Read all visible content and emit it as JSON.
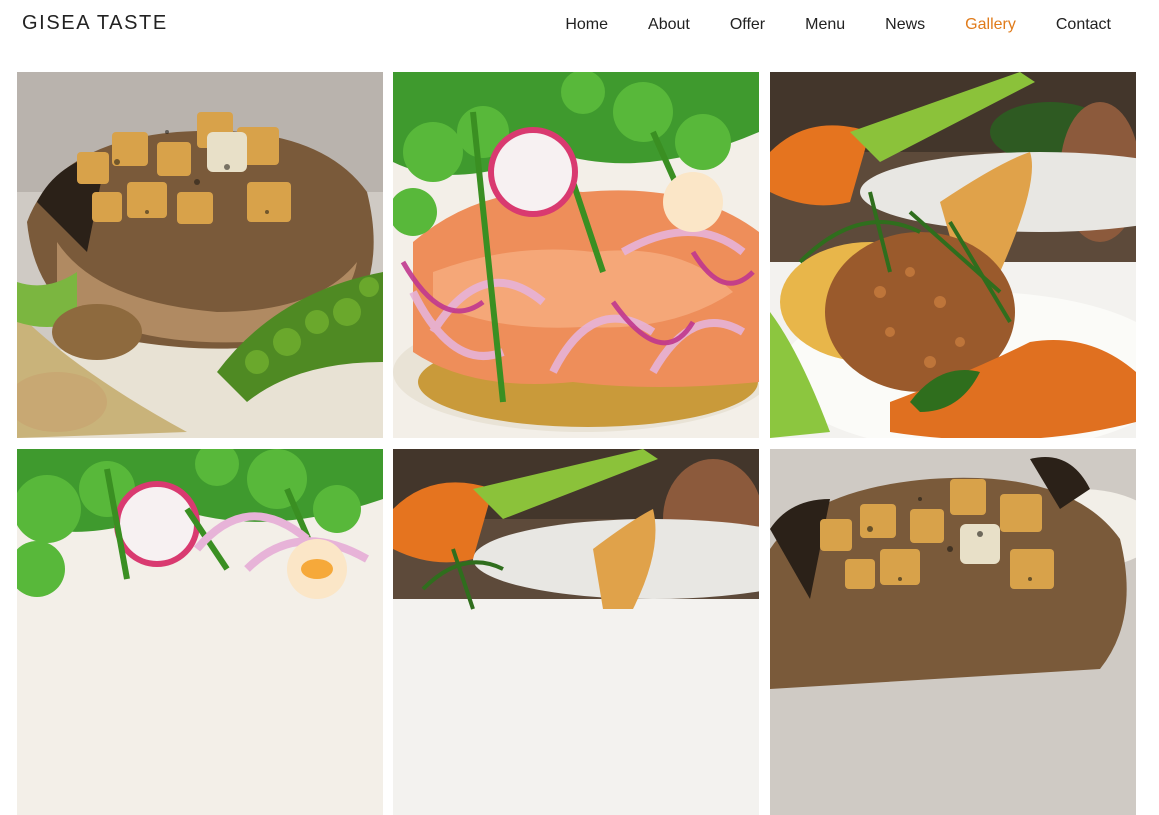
{
  "brand": {
    "name": "GISEA TASTE"
  },
  "nav": {
    "items": [
      {
        "label": "Home",
        "active": false
      },
      {
        "label": "About",
        "active": false
      },
      {
        "label": "Offer",
        "active": false
      },
      {
        "label": "Menu",
        "active": false
      },
      {
        "label": "News",
        "active": false
      },
      {
        "label": "Gallery",
        "active": true
      },
      {
        "label": "Contact",
        "active": false
      }
    ],
    "active_color": "#e07b1a"
  },
  "gallery": {
    "tiles": [
      {
        "subject": "pork-steak-potatoes"
      },
      {
        "subject": "salmon-radish-salad"
      },
      {
        "subject": "croquette-carrot"
      },
      {
        "subject": "salmon-radish-salad"
      },
      {
        "subject": "croquette-carrot"
      },
      {
        "subject": "pork-steak-potatoes"
      }
    ]
  }
}
